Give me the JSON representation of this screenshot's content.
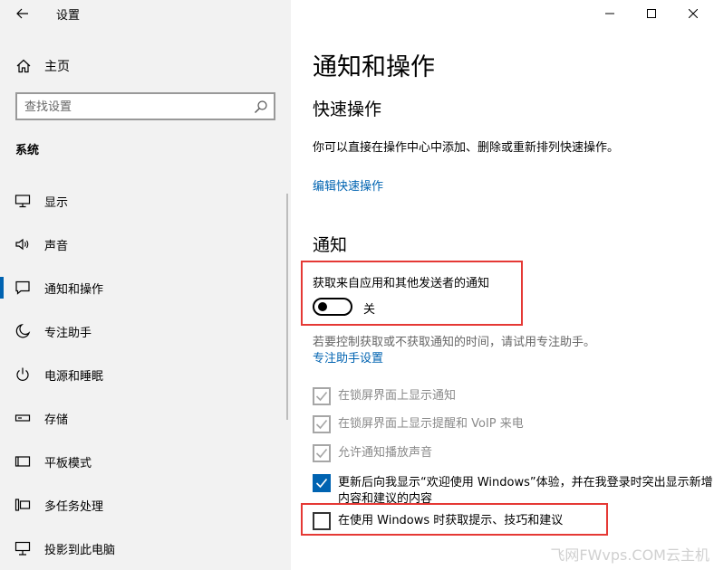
{
  "app": {
    "title": "设置"
  },
  "sidebar": {
    "home_label": "主页",
    "search_placeholder": "查找设置",
    "section_title": "系统",
    "items": [
      {
        "label": "显示",
        "icon": "monitor-icon"
      },
      {
        "label": "声音",
        "icon": "speaker-icon"
      },
      {
        "label": "通知和操作",
        "icon": "notification-icon",
        "active": true
      },
      {
        "label": "专注助手",
        "icon": "moon-icon"
      },
      {
        "label": "电源和睡眠",
        "icon": "power-icon"
      },
      {
        "label": "存储",
        "icon": "storage-icon"
      },
      {
        "label": "平板模式",
        "icon": "tablet-icon"
      },
      {
        "label": "多任务处理",
        "icon": "multitask-icon"
      },
      {
        "label": "投影到此电脑",
        "icon": "project-icon"
      }
    ]
  },
  "main": {
    "page_title": "通知和操作",
    "quick_actions": {
      "heading": "快速操作",
      "description": "你可以直接在操作中心中添加、删除或重新排列快速操作。",
      "edit_link": "编辑快速操作"
    },
    "notifications": {
      "heading": "通知",
      "toggle_label": "获取来自应用和其他发送者的通知",
      "toggle_state": "关",
      "toggle_on": false,
      "focus_hint": "若要控制获取或不获取通知的时间，请试用专注助手。",
      "focus_link": "专注助手设置",
      "checkboxes": [
        {
          "label": "在锁屏界面上显示通知",
          "checked": true,
          "disabled": true
        },
        {
          "label": "在锁屏界面上显示提醒和 VoIP 来电",
          "checked": true,
          "disabled": true
        },
        {
          "label": "允许通知播放声音",
          "checked": true,
          "disabled": true
        },
        {
          "label": "更新后向我显示“欢迎使用 Windows”体验，并在我登录时突出显示新增内容和建议的内容",
          "checked": true,
          "disabled": false
        },
        {
          "label": "在使用 Windows 时获取提示、技巧和建议",
          "checked": false,
          "disabled": false
        }
      ]
    }
  },
  "watermark": "飞网FWvps.COM云主机",
  "colors": {
    "accent": "#0063b1",
    "highlight": "#e53935",
    "sidebar_bg": "#f2f2f2"
  }
}
